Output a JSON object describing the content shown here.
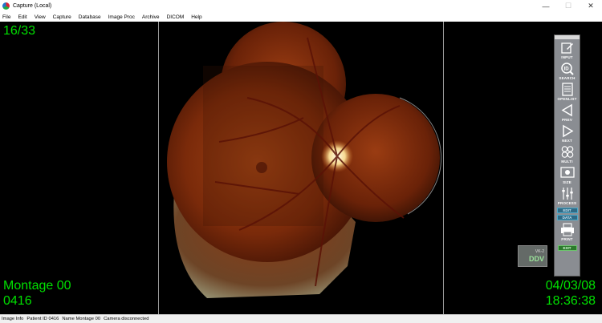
{
  "window": {
    "title": "Capture (Local)",
    "controls": {
      "minimize": "—",
      "maximize": "☐",
      "close": "✕"
    }
  },
  "menu": [
    "File",
    "Edit",
    "View",
    "Capture",
    "Database",
    "Image Proc",
    "Archive",
    "DICOM",
    "Help"
  ],
  "overlay": {
    "counter": "16/33",
    "montage": "Montage 00",
    "patient_id": "0416",
    "date": "04/03/08",
    "time": "18:36:38"
  },
  "toolbar": {
    "input": "INPUT",
    "search": "SEARCH",
    "openlist": "OPENLIST",
    "prev": "PREV",
    "next": "NEXT",
    "multi": "MULTI",
    "size": "SIZE",
    "process": "PROCESS",
    "edit": "EDIT",
    "data": "DATA",
    "print": "PRINT",
    "exit": "EXIT"
  },
  "thumbnail": {
    "line1": "VK-2",
    "line2": "DDV"
  },
  "status": {
    "image_info": "Image Info",
    "patient_id": "Patient ID 0416",
    "name": "Name Montage 00",
    "camera": "Camera disconnected"
  },
  "colors": {
    "overlay_text": "#00e000",
    "toolbar_bg": "#8a8d92",
    "fundus_dark": "#2a0a02",
    "fundus_mid": "#8a2e0e",
    "optic_disc": "#fff2c8"
  }
}
